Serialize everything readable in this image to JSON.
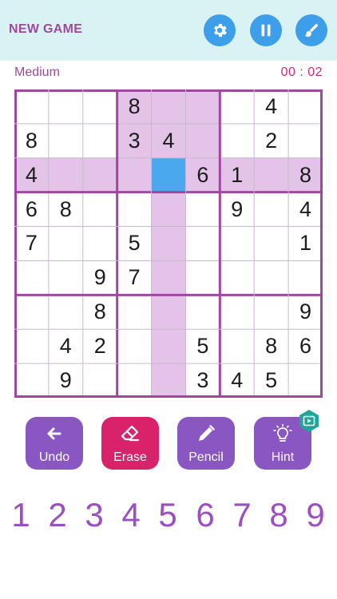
{
  "header": {
    "new_game_label": "NEW GAME",
    "buttons": [
      {
        "icon": "gear-icon"
      },
      {
        "icon": "pause-icon"
      },
      {
        "icon": "brush-icon"
      }
    ],
    "accent_color": "#3d9ee9",
    "background_color": "#d9f3f4"
  },
  "status": {
    "difficulty": "Medium",
    "timer": "00 : 02"
  },
  "board": {
    "selected": {
      "row": 2,
      "col": 4
    },
    "grid": [
      [
        "",
        "",
        "",
        "8",
        "",
        "",
        "",
        "4",
        ""
      ],
      [
        "8",
        "",
        "",
        "3",
        "4",
        "",
        "",
        "2",
        ""
      ],
      [
        "4",
        "",
        "",
        "",
        "",
        "6",
        "1",
        "",
        "8"
      ],
      [
        "6",
        "8",
        "",
        "",
        "",
        "",
        "9",
        "",
        "4"
      ],
      [
        "7",
        "",
        "",
        "5",
        "",
        "",
        "",
        "",
        "1"
      ],
      [
        "",
        "",
        "9",
        "7",
        "",
        "",
        "",
        "",
        ""
      ],
      [
        "",
        "",
        "8",
        "",
        "",
        "",
        "",
        "",
        "9"
      ],
      [
        "",
        "4",
        "2",
        "",
        "",
        "5",
        "",
        "8",
        "6"
      ],
      [
        "",
        "9",
        "",
        "",
        "",
        "3",
        "4",
        "5",
        ""
      ]
    ],
    "highlight_color": "#e3c4e8",
    "selected_color": "#4aa8ef",
    "border_color": "#a0479f"
  },
  "actions": [
    {
      "label": "Undo",
      "icon": "undo-arrow-icon"
    },
    {
      "label": "Erase",
      "icon": "eraser-icon"
    },
    {
      "label": "Pencil",
      "icon": "pencil-icon"
    },
    {
      "label": "Hint",
      "icon": "lightbulb-icon"
    }
  ],
  "numpad": [
    "1",
    "2",
    "3",
    "4",
    "5",
    "6",
    "7",
    "8",
    "9"
  ]
}
